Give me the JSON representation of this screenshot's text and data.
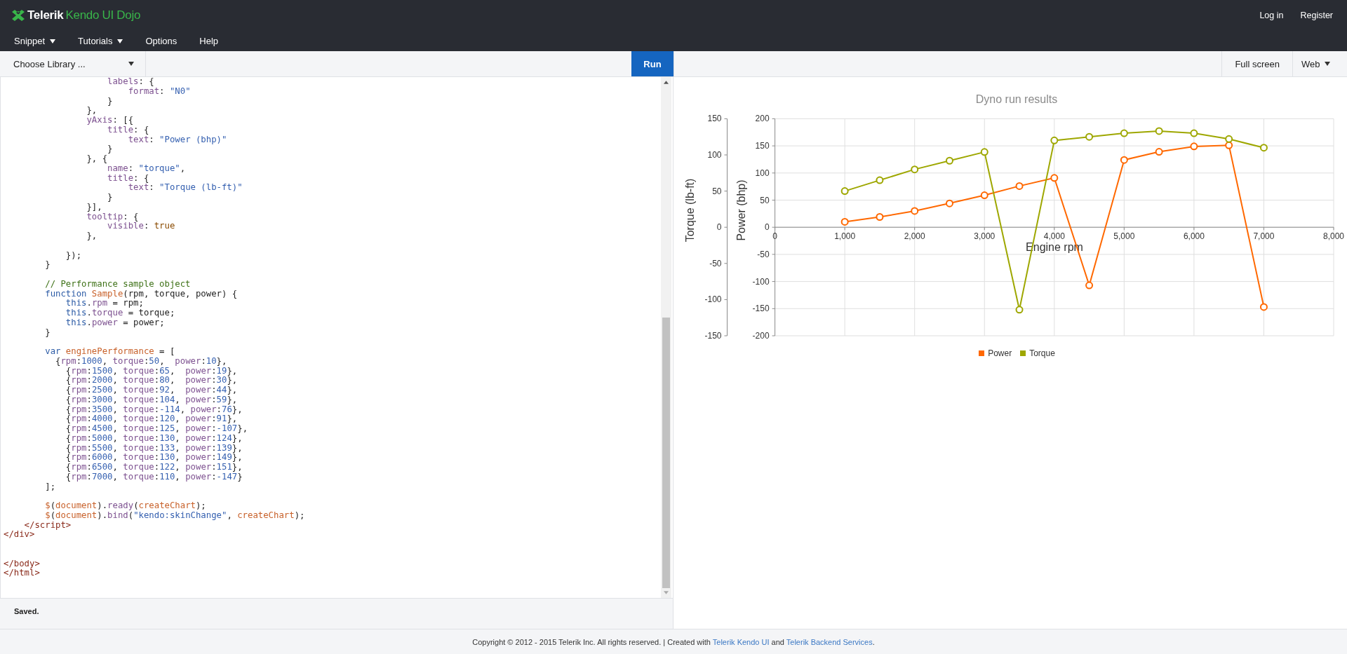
{
  "header": {
    "logo": {
      "brand": "Telerik",
      "product": "Kendo UI Dojo"
    },
    "menu": [
      {
        "label": "Snippet",
        "has_menu": true
      },
      {
        "label": "Tutorials",
        "has_menu": true
      },
      {
        "label": "Options",
        "has_menu": false
      },
      {
        "label": "Help",
        "has_menu": false
      }
    ],
    "account_links": [
      "Log in",
      "Register"
    ]
  },
  "toolbar": {
    "library_dropdown": "Choose Library ...",
    "run_button": "Run",
    "full_screen_button": "Full screen",
    "view_dropdown": "Web"
  },
  "editor": {
    "lines": [
      {
        "kind": "code",
        "tokens": [
          {
            "kind": "property",
            "text": "                    labels"
          },
          {
            "kind": "plain",
            "text": ": {"
          }
        ]
      },
      {
        "kind": "code",
        "tokens": [
          {
            "kind": "property",
            "text": "                        format"
          },
          {
            "kind": "plain",
            "text": ": "
          },
          {
            "kind": "string",
            "text": "\"N0\""
          }
        ]
      },
      {
        "kind": "code",
        "tokens": [
          {
            "kind": "plain",
            "text": "                    }"
          }
        ]
      },
      {
        "kind": "code",
        "tokens": [
          {
            "kind": "plain",
            "text": "                },"
          }
        ]
      },
      {
        "kind": "code",
        "tokens": [
          {
            "kind": "property",
            "text": "                yAxis"
          },
          {
            "kind": "plain",
            "text": ": [{"
          }
        ]
      },
      {
        "kind": "code",
        "tokens": [
          {
            "kind": "property",
            "text": "                    title"
          },
          {
            "kind": "plain",
            "text": ": {"
          }
        ]
      },
      {
        "kind": "code",
        "tokens": [
          {
            "kind": "property",
            "text": "                        text"
          },
          {
            "kind": "plain",
            "text": ": "
          },
          {
            "kind": "string",
            "text": "\"Power (bhp)\""
          }
        ]
      },
      {
        "kind": "code",
        "tokens": [
          {
            "kind": "plain",
            "text": "                    }"
          }
        ]
      },
      {
        "kind": "code",
        "tokens": [
          {
            "kind": "plain",
            "text": "                }, {"
          }
        ]
      },
      {
        "kind": "code",
        "tokens": [
          {
            "kind": "property",
            "text": "                    name"
          },
          {
            "kind": "plain",
            "text": ": "
          },
          {
            "kind": "string",
            "text": "\"torque\""
          },
          {
            "kind": "plain",
            "text": ","
          }
        ]
      },
      {
        "kind": "code",
        "tokens": [
          {
            "kind": "property",
            "text": "                    title"
          },
          {
            "kind": "plain",
            "text": ": {"
          }
        ]
      },
      {
        "kind": "code",
        "tokens": [
          {
            "kind": "property",
            "text": "                        text"
          },
          {
            "kind": "plain",
            "text": ": "
          },
          {
            "kind": "string",
            "text": "\"Torque (lb-ft)\""
          }
        ]
      },
      {
        "kind": "code",
        "tokens": [
          {
            "kind": "plain",
            "text": "                    }"
          }
        ]
      },
      {
        "kind": "code",
        "tokens": [
          {
            "kind": "plain",
            "text": "                }],"
          }
        ]
      },
      {
        "kind": "code",
        "tokens": [
          {
            "kind": "property",
            "text": "                tooltip"
          },
          {
            "kind": "plain",
            "text": ": {"
          }
        ]
      },
      {
        "kind": "code",
        "tokens": [
          {
            "kind": "property",
            "text": "                    visible"
          },
          {
            "kind": "plain",
            "text": ": "
          },
          {
            "kind": "literal",
            "text": "true"
          }
        ]
      },
      {
        "kind": "code",
        "tokens": [
          {
            "kind": "plain",
            "text": "                },"
          }
        ]
      },
      {
        "kind": "blank"
      },
      {
        "kind": "code",
        "tokens": [
          {
            "kind": "plain",
            "text": "            });"
          }
        ]
      },
      {
        "kind": "code",
        "tokens": [
          {
            "kind": "plain",
            "text": "        }"
          }
        ]
      },
      {
        "kind": "blank"
      },
      {
        "kind": "code",
        "tokens": [
          {
            "kind": "comment",
            "text": "        // Performance sample object"
          }
        ]
      },
      {
        "kind": "code",
        "tokens": [
          {
            "kind": "keyword",
            "text": "        function "
          },
          {
            "kind": "name",
            "text": "Sample"
          },
          {
            "kind": "plain",
            "text": "(rpm, torque, power) {"
          }
        ]
      },
      {
        "kind": "code",
        "tokens": [
          {
            "kind": "keyword",
            "text": "            this"
          },
          {
            "kind": "plain",
            "text": "."
          },
          {
            "kind": "property",
            "text": "rpm"
          },
          {
            "kind": "plain",
            "text": " = rpm;"
          }
        ]
      },
      {
        "kind": "code",
        "tokens": [
          {
            "kind": "keyword",
            "text": "            this"
          },
          {
            "kind": "plain",
            "text": "."
          },
          {
            "kind": "property",
            "text": "torque"
          },
          {
            "kind": "plain",
            "text": " = torque;"
          }
        ]
      },
      {
        "kind": "code",
        "tokens": [
          {
            "kind": "keyword",
            "text": "            this"
          },
          {
            "kind": "plain",
            "text": "."
          },
          {
            "kind": "property",
            "text": "power"
          },
          {
            "kind": "plain",
            "text": " = power;"
          }
        ]
      },
      {
        "kind": "code",
        "tokens": [
          {
            "kind": "plain",
            "text": "        }"
          }
        ]
      },
      {
        "kind": "blank"
      },
      {
        "kind": "code",
        "tokens": [
          {
            "kind": "keyword",
            "text": "        var "
          },
          {
            "kind": "name",
            "text": "enginePerformance"
          },
          {
            "kind": "plain",
            "text": " = ["
          }
        ]
      },
      {
        "kind": "code",
        "tokens": [
          {
            "kind": "plain",
            "text": "          {"
          },
          {
            "kind": "property",
            "text": "rpm"
          },
          {
            "kind": "plain",
            "text": ":"
          },
          {
            "kind": "number",
            "text": "1000"
          },
          {
            "kind": "plain",
            "text": ", "
          },
          {
            "kind": "property",
            "text": "torque"
          },
          {
            "kind": "plain",
            "text": ":"
          },
          {
            "kind": "number",
            "text": "50"
          },
          {
            "kind": "plain",
            "text": ",  "
          },
          {
            "kind": "property",
            "text": "power"
          },
          {
            "kind": "plain",
            "text": ":"
          },
          {
            "kind": "number",
            "text": "10"
          },
          {
            "kind": "plain",
            "text": "},"
          }
        ]
      },
      {
        "kind": "code",
        "tokens": [
          {
            "kind": "plain",
            "text": "            {"
          },
          {
            "kind": "property",
            "text": "rpm"
          },
          {
            "kind": "plain",
            "text": ":"
          },
          {
            "kind": "number",
            "text": "1500"
          },
          {
            "kind": "plain",
            "text": ", "
          },
          {
            "kind": "property",
            "text": "torque"
          },
          {
            "kind": "plain",
            "text": ":"
          },
          {
            "kind": "number",
            "text": "65"
          },
          {
            "kind": "plain",
            "text": ",  "
          },
          {
            "kind": "property",
            "text": "power"
          },
          {
            "kind": "plain",
            "text": ":"
          },
          {
            "kind": "number",
            "text": "19"
          },
          {
            "kind": "plain",
            "text": "},"
          }
        ]
      },
      {
        "kind": "code",
        "tokens": [
          {
            "kind": "plain",
            "text": "            {"
          },
          {
            "kind": "property",
            "text": "rpm"
          },
          {
            "kind": "plain",
            "text": ":"
          },
          {
            "kind": "number",
            "text": "2000"
          },
          {
            "kind": "plain",
            "text": ", "
          },
          {
            "kind": "property",
            "text": "torque"
          },
          {
            "kind": "plain",
            "text": ":"
          },
          {
            "kind": "number",
            "text": "80"
          },
          {
            "kind": "plain",
            "text": ",  "
          },
          {
            "kind": "property",
            "text": "power"
          },
          {
            "kind": "plain",
            "text": ":"
          },
          {
            "kind": "number",
            "text": "30"
          },
          {
            "kind": "plain",
            "text": "},"
          }
        ]
      },
      {
        "kind": "code",
        "tokens": [
          {
            "kind": "plain",
            "text": "            {"
          },
          {
            "kind": "property",
            "text": "rpm"
          },
          {
            "kind": "plain",
            "text": ":"
          },
          {
            "kind": "number",
            "text": "2500"
          },
          {
            "kind": "plain",
            "text": ", "
          },
          {
            "kind": "property",
            "text": "torque"
          },
          {
            "kind": "plain",
            "text": ":"
          },
          {
            "kind": "number",
            "text": "92"
          },
          {
            "kind": "plain",
            "text": ",  "
          },
          {
            "kind": "property",
            "text": "power"
          },
          {
            "kind": "plain",
            "text": ":"
          },
          {
            "kind": "number",
            "text": "44"
          },
          {
            "kind": "plain",
            "text": "},"
          }
        ]
      },
      {
        "kind": "code",
        "tokens": [
          {
            "kind": "plain",
            "text": "            {"
          },
          {
            "kind": "property",
            "text": "rpm"
          },
          {
            "kind": "plain",
            "text": ":"
          },
          {
            "kind": "number",
            "text": "3000"
          },
          {
            "kind": "plain",
            "text": ", "
          },
          {
            "kind": "property",
            "text": "torque"
          },
          {
            "kind": "plain",
            "text": ":"
          },
          {
            "kind": "number",
            "text": "104"
          },
          {
            "kind": "plain",
            "text": ", "
          },
          {
            "kind": "property",
            "text": "power"
          },
          {
            "kind": "plain",
            "text": ":"
          },
          {
            "kind": "number",
            "text": "59"
          },
          {
            "kind": "plain",
            "text": "},"
          }
        ]
      },
      {
        "kind": "code",
        "tokens": [
          {
            "kind": "plain",
            "text": "            {"
          },
          {
            "kind": "property",
            "text": "rpm"
          },
          {
            "kind": "plain",
            "text": ":"
          },
          {
            "kind": "number",
            "text": "3500"
          },
          {
            "kind": "plain",
            "text": ", "
          },
          {
            "kind": "property",
            "text": "torque"
          },
          {
            "kind": "plain",
            "text": ":"
          },
          {
            "kind": "number",
            "text": "-114"
          },
          {
            "kind": "plain",
            "text": ", "
          },
          {
            "kind": "property",
            "text": "power"
          },
          {
            "kind": "plain",
            "text": ":"
          },
          {
            "kind": "number",
            "text": "76"
          },
          {
            "kind": "plain",
            "text": "},"
          }
        ]
      },
      {
        "kind": "code",
        "tokens": [
          {
            "kind": "plain",
            "text": "            {"
          },
          {
            "kind": "property",
            "text": "rpm"
          },
          {
            "kind": "plain",
            "text": ":"
          },
          {
            "kind": "number",
            "text": "4000"
          },
          {
            "kind": "plain",
            "text": ", "
          },
          {
            "kind": "property",
            "text": "torque"
          },
          {
            "kind": "plain",
            "text": ":"
          },
          {
            "kind": "number",
            "text": "120"
          },
          {
            "kind": "plain",
            "text": ", "
          },
          {
            "kind": "property",
            "text": "power"
          },
          {
            "kind": "plain",
            "text": ":"
          },
          {
            "kind": "number",
            "text": "91"
          },
          {
            "kind": "plain",
            "text": "},"
          }
        ]
      },
      {
        "kind": "code",
        "tokens": [
          {
            "kind": "plain",
            "text": "            {"
          },
          {
            "kind": "property",
            "text": "rpm"
          },
          {
            "kind": "plain",
            "text": ":"
          },
          {
            "kind": "number",
            "text": "4500"
          },
          {
            "kind": "plain",
            "text": ", "
          },
          {
            "kind": "property",
            "text": "torque"
          },
          {
            "kind": "plain",
            "text": ":"
          },
          {
            "kind": "number",
            "text": "125"
          },
          {
            "kind": "plain",
            "text": ", "
          },
          {
            "kind": "property",
            "text": "power"
          },
          {
            "kind": "plain",
            "text": ":"
          },
          {
            "kind": "number",
            "text": "-107"
          },
          {
            "kind": "plain",
            "text": "},"
          }
        ]
      },
      {
        "kind": "code",
        "tokens": [
          {
            "kind": "plain",
            "text": "            {"
          },
          {
            "kind": "property",
            "text": "rpm"
          },
          {
            "kind": "plain",
            "text": ":"
          },
          {
            "kind": "number",
            "text": "5000"
          },
          {
            "kind": "plain",
            "text": ", "
          },
          {
            "kind": "property",
            "text": "torque"
          },
          {
            "kind": "plain",
            "text": ":"
          },
          {
            "kind": "number",
            "text": "130"
          },
          {
            "kind": "plain",
            "text": ", "
          },
          {
            "kind": "property",
            "text": "power"
          },
          {
            "kind": "plain",
            "text": ":"
          },
          {
            "kind": "number",
            "text": "124"
          },
          {
            "kind": "plain",
            "text": "},"
          }
        ]
      },
      {
        "kind": "code",
        "tokens": [
          {
            "kind": "plain",
            "text": "            {"
          },
          {
            "kind": "property",
            "text": "rpm"
          },
          {
            "kind": "plain",
            "text": ":"
          },
          {
            "kind": "number",
            "text": "5500"
          },
          {
            "kind": "plain",
            "text": ", "
          },
          {
            "kind": "property",
            "text": "torque"
          },
          {
            "kind": "plain",
            "text": ":"
          },
          {
            "kind": "number",
            "text": "133"
          },
          {
            "kind": "plain",
            "text": ", "
          },
          {
            "kind": "property",
            "text": "power"
          },
          {
            "kind": "plain",
            "text": ":"
          },
          {
            "kind": "number",
            "text": "139"
          },
          {
            "kind": "plain",
            "text": "},"
          }
        ]
      },
      {
        "kind": "code",
        "tokens": [
          {
            "kind": "plain",
            "text": "            {"
          },
          {
            "kind": "property",
            "text": "rpm"
          },
          {
            "kind": "plain",
            "text": ":"
          },
          {
            "kind": "number",
            "text": "6000"
          },
          {
            "kind": "plain",
            "text": ", "
          },
          {
            "kind": "property",
            "text": "torque"
          },
          {
            "kind": "plain",
            "text": ":"
          },
          {
            "kind": "number",
            "text": "130"
          },
          {
            "kind": "plain",
            "text": ", "
          },
          {
            "kind": "property",
            "text": "power"
          },
          {
            "kind": "plain",
            "text": ":"
          },
          {
            "kind": "number",
            "text": "149"
          },
          {
            "kind": "plain",
            "text": "},"
          }
        ]
      },
      {
        "kind": "code",
        "tokens": [
          {
            "kind": "plain",
            "text": "            {"
          },
          {
            "kind": "property",
            "text": "rpm"
          },
          {
            "kind": "plain",
            "text": ":"
          },
          {
            "kind": "number",
            "text": "6500"
          },
          {
            "kind": "plain",
            "text": ", "
          },
          {
            "kind": "property",
            "text": "torque"
          },
          {
            "kind": "plain",
            "text": ":"
          },
          {
            "kind": "number",
            "text": "122"
          },
          {
            "kind": "plain",
            "text": ", "
          },
          {
            "kind": "property",
            "text": "power"
          },
          {
            "kind": "plain",
            "text": ":"
          },
          {
            "kind": "number",
            "text": "151"
          },
          {
            "kind": "plain",
            "text": "},"
          }
        ]
      },
      {
        "kind": "code",
        "tokens": [
          {
            "kind": "plain",
            "text": "            {"
          },
          {
            "kind": "property",
            "text": "rpm"
          },
          {
            "kind": "plain",
            "text": ":"
          },
          {
            "kind": "number",
            "text": "7000"
          },
          {
            "kind": "plain",
            "text": ", "
          },
          {
            "kind": "property",
            "text": "torque"
          },
          {
            "kind": "plain",
            "text": ":"
          },
          {
            "kind": "number",
            "text": "110"
          },
          {
            "kind": "plain",
            "text": ", "
          },
          {
            "kind": "property",
            "text": "power"
          },
          {
            "kind": "plain",
            "text": ":"
          },
          {
            "kind": "number",
            "text": "-147"
          },
          {
            "kind": "plain",
            "text": "}"
          }
        ]
      },
      {
        "kind": "code",
        "tokens": [
          {
            "kind": "plain",
            "text": "        ];"
          }
        ]
      },
      {
        "kind": "blank"
      },
      {
        "kind": "code",
        "tokens": [
          {
            "kind": "name",
            "text": "        $"
          },
          {
            "kind": "plain",
            "text": "("
          },
          {
            "kind": "name",
            "text": "document"
          },
          {
            "kind": "plain",
            "text": ")."
          },
          {
            "kind": "property",
            "text": "ready"
          },
          {
            "kind": "plain",
            "text": "("
          },
          {
            "kind": "name",
            "text": "createChart"
          },
          {
            "kind": "plain",
            "text": ");"
          }
        ]
      },
      {
        "kind": "code",
        "tokens": [
          {
            "kind": "name",
            "text": "        $"
          },
          {
            "kind": "plain",
            "text": "("
          },
          {
            "kind": "name",
            "text": "document"
          },
          {
            "kind": "plain",
            "text": ")."
          },
          {
            "kind": "property",
            "text": "bind"
          },
          {
            "kind": "plain",
            "text": "("
          },
          {
            "kind": "string",
            "text": "\"kendo:skinChange\""
          },
          {
            "kind": "plain",
            "text": ", "
          },
          {
            "kind": "name",
            "text": "createChart"
          },
          {
            "kind": "plain",
            "text": ");"
          }
        ]
      },
      {
        "kind": "code",
        "tokens": [
          {
            "kind": "tag",
            "text": "    </script>"
          }
        ]
      },
      {
        "kind": "code",
        "tokens": [
          {
            "kind": "tag",
            "text": "</div>"
          }
        ]
      },
      {
        "kind": "blank"
      },
      {
        "kind": "blank"
      },
      {
        "kind": "code",
        "tokens": [
          {
            "kind": "tag",
            "text": "</body>"
          }
        ]
      },
      {
        "kind": "code",
        "tokens": [
          {
            "kind": "tag",
            "text": "</html>"
          }
        ]
      }
    ],
    "status": "Saved."
  },
  "preview": {
    "chart_data": {
      "type": "line",
      "title": "Dyno run results",
      "xlabel": "Engine rpm",
      "ylabel": "Torque (lb-ft)",
      "y2label": "Power (bhp)",
      "grid": {
        "x": true,
        "y": true
      },
      "legend": true,
      "x": [
        1000,
        1500,
        2000,
        2500,
        3000,
        3500,
        4000,
        4500,
        5000,
        5500,
        6000,
        6500,
        7000
      ],
      "series": [
        {
          "name": "Power",
          "color": "#ff6800",
          "axis": "y2",
          "marker": "circle",
          "values": [
            10,
            19,
            30,
            44,
            59,
            76,
            91,
            -107,
            124,
            139,
            149,
            151,
            -147
          ]
        },
        {
          "name": "Torque",
          "color": "#9ea700",
          "marker": "circle",
          "values": [
            50,
            65,
            80,
            92,
            104,
            -114,
            120,
            125,
            130,
            133,
            130,
            122,
            110
          ]
        }
      ],
      "xlim": [
        0,
        8000
      ],
      "ylim": [
        -150,
        150
      ],
      "y2lim": [
        -200,
        200
      ],
      "xticks": [
        {
          "value": 0,
          "label": "0"
        },
        {
          "value": 1000,
          "label": "1,000"
        },
        {
          "value": 2000,
          "label": "2,000"
        },
        {
          "value": 3000,
          "label": "3,000"
        },
        {
          "value": 4000,
          "label": "4,000"
        },
        {
          "value": 5000,
          "label": "5,000"
        },
        {
          "value": 6000,
          "label": "6,000"
        },
        {
          "value": 7000,
          "label": "7,000"
        },
        {
          "value": 8000,
          "label": "8,000"
        }
      ],
      "yticks": [
        -150,
        -100,
        -50,
        0,
        50,
        100,
        150
      ],
      "y2ticks": [
        -200,
        -150,
        -100,
        -50,
        0,
        50,
        100,
        150,
        200
      ]
    }
  },
  "footer": {
    "parts": [
      {
        "kind": "text",
        "text": "Copyright © 2012 - 2015 Telerik Inc. All rights reserved. | Created with "
      },
      {
        "kind": "link",
        "text": "Telerik Kendo UI"
      },
      {
        "kind": "text",
        "text": " and "
      },
      {
        "kind": "link",
        "text": "Telerik Backend Services"
      },
      {
        "kind": "text",
        "text": "."
      }
    ]
  }
}
